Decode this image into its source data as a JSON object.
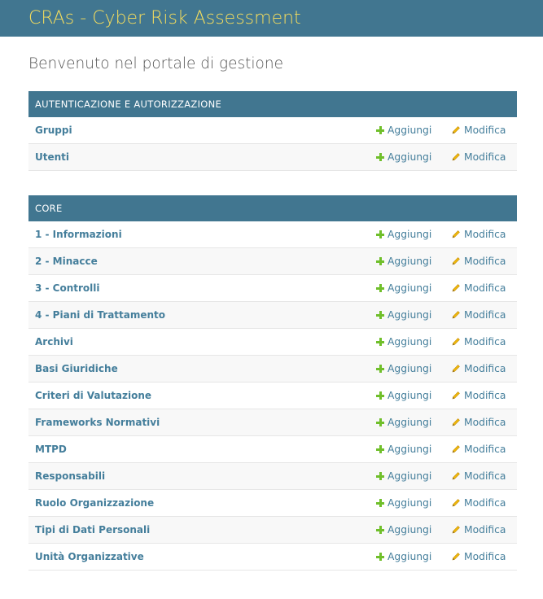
{
  "header": {
    "title": "CRAs - Cyber Risk Assessment"
  },
  "welcome": "Benvenuto nel portale di gestione",
  "actions": {
    "add_label": "Aggiungi",
    "edit_label": "Modifica"
  },
  "modules": [
    {
      "caption": "AUTENTICAZIONE E AUTORIZZAZIONE",
      "models": [
        "Gruppi",
        "Utenti"
      ]
    },
    {
      "caption": "CORE",
      "models": [
        "1 - Informazioni",
        "2 - Minacce",
        "3 - Controlli",
        "4 - Piani di Trattamento",
        "Archivi",
        "Basi Giuridiche",
        "Criteri di Valutazione",
        "Frameworks Normativi",
        "MTPD",
        "Responsabili",
        "Ruolo Organizzazione",
        "Tipi di Dati Personali",
        "Unità Organizzative"
      ]
    }
  ],
  "colors": {
    "header_bg": "#417690",
    "title_yellow": "#f5dd5d",
    "link": "#447e9b",
    "add_green": "#70bf2b",
    "edit_gold": "#efb80b"
  }
}
